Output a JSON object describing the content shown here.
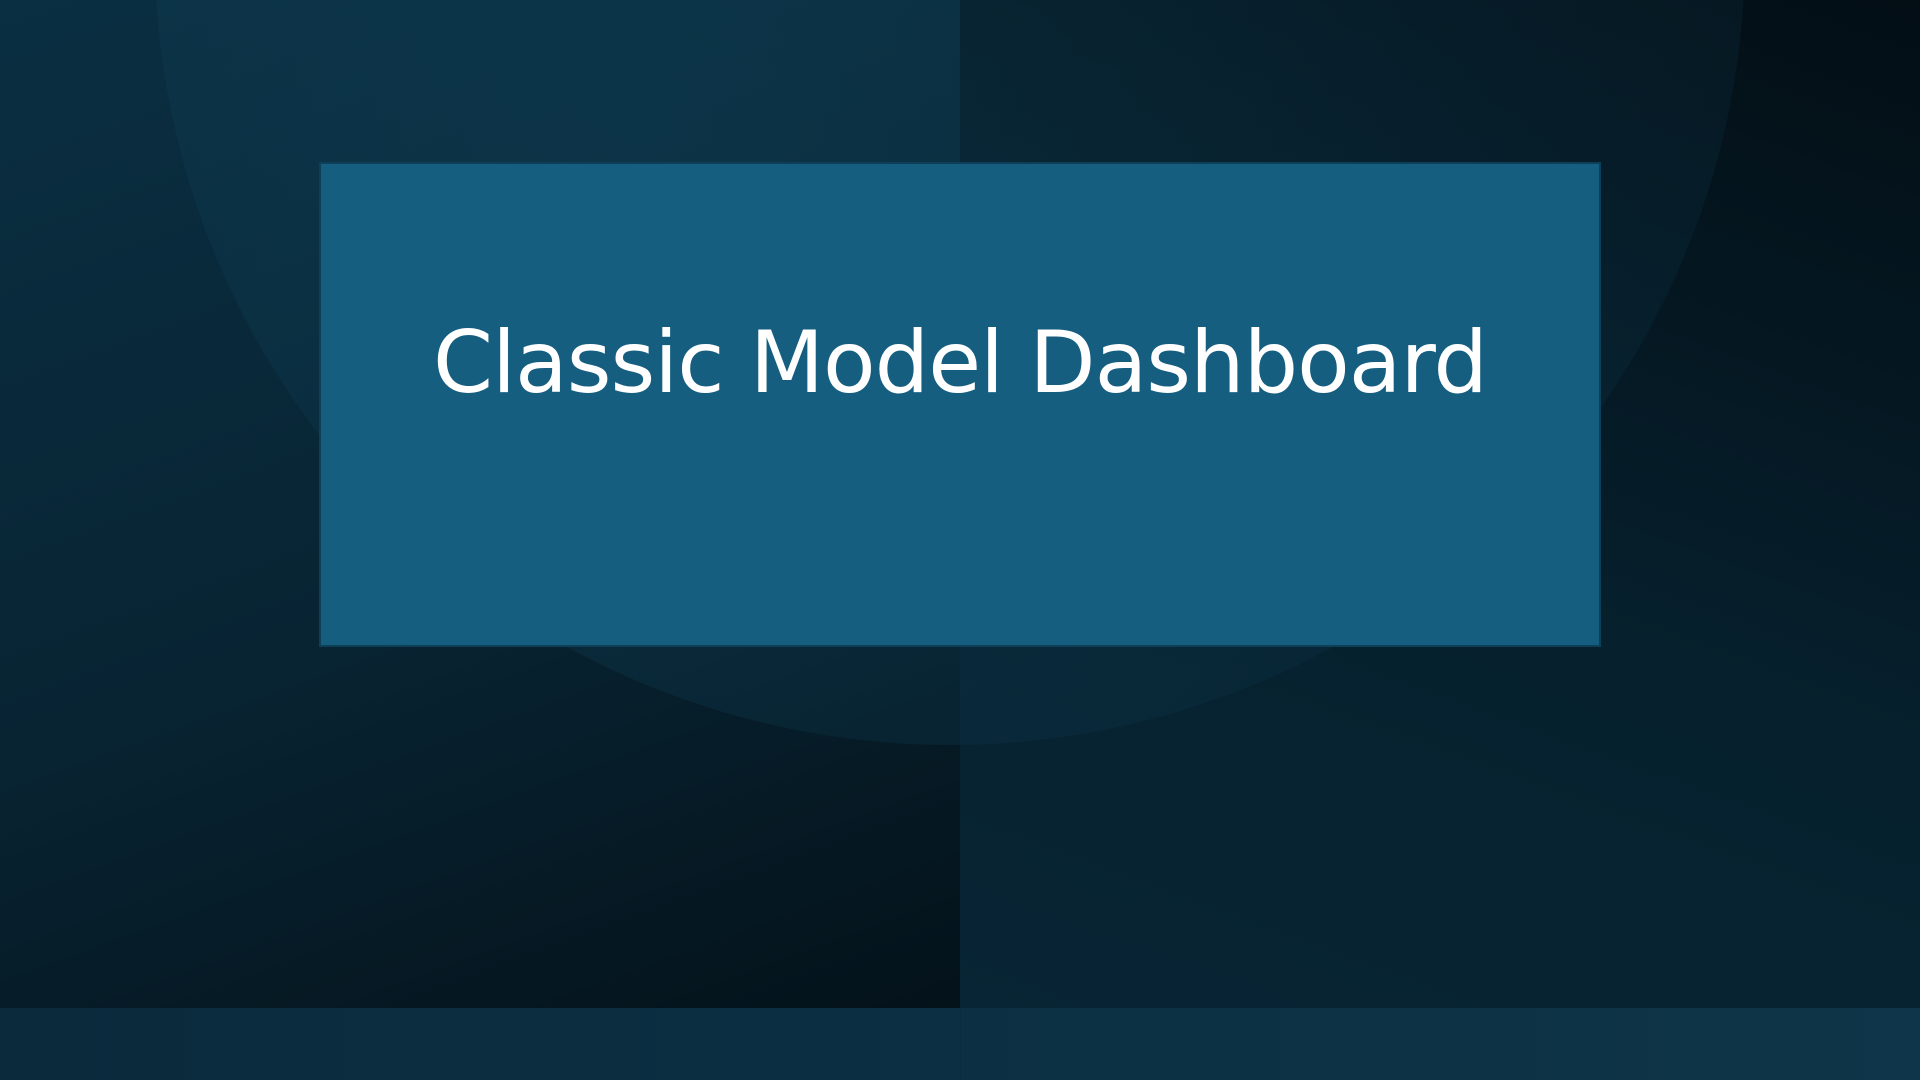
{
  "slide": {
    "title": "Classic Model Dashboard"
  },
  "colors": {
    "background_dark": "#061a24",
    "title_box": "#165e80",
    "title_text": "#ffffff",
    "bottom_band": "#0c2f43"
  }
}
